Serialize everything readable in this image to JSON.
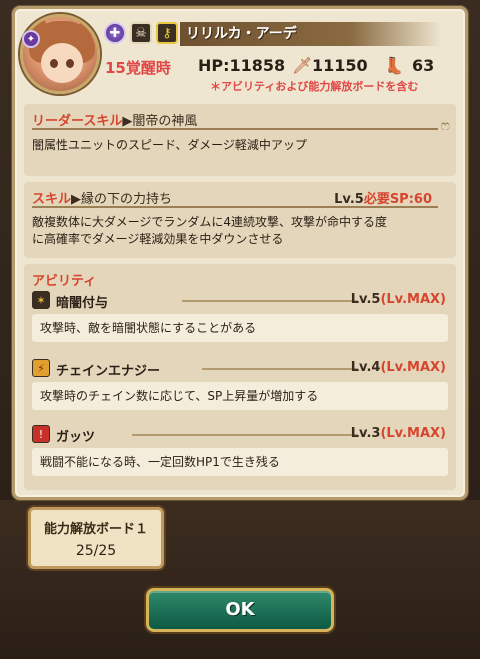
{
  "header": {
    "name": "リリルカ・アーデ",
    "awakening": "15覚醒時",
    "hp": "HP:11858",
    "atk": "11150",
    "def": "63",
    "note": "＊アビリティおよび能力解放ボードを含む",
    "badge": "✦",
    "attr_icons": [
      "dark-element-icon",
      "skull-icon",
      "key-icon"
    ]
  },
  "leader_skill": {
    "title": "リーダースキル",
    "name": "闇帝の神風",
    "description": "闇属性ユニットのスピード、ダメージ軽減中アップ"
  },
  "skill": {
    "title": "スキル",
    "name": "縁の下の力持ち",
    "level": "Lv.5",
    "sp": "必要SP:60",
    "description_line1": "敵複数体に大ダメージでランダムに4連続攻撃、攻撃が命中する度",
    "description_line2": "に高確率でダメージ軽減効果を中ダウンさせる"
  },
  "abilities": {
    "title": "アビリティ",
    "items": [
      {
        "name": "暗闇付与",
        "level": "Lv.5",
        "max": "(Lv.MAX)",
        "description": "攻撃時、敵を暗闇状態にすることがある"
      },
      {
        "name": "チェインエナジー",
        "level": "Lv.4",
        "max": "(Lv.MAX)",
        "description": "攻撃時のチェイン数に応じて、SP上昇量が増加する"
      },
      {
        "name": "ガッツ",
        "level": "Lv.3",
        "max": "(Lv.MAX)",
        "description": "戦闘不能になる時、一定回数HP1で生き残る"
      }
    ]
  },
  "board": {
    "label": "能力解放ボード１",
    "progress": "25/25"
  },
  "ok_button": "OK"
}
